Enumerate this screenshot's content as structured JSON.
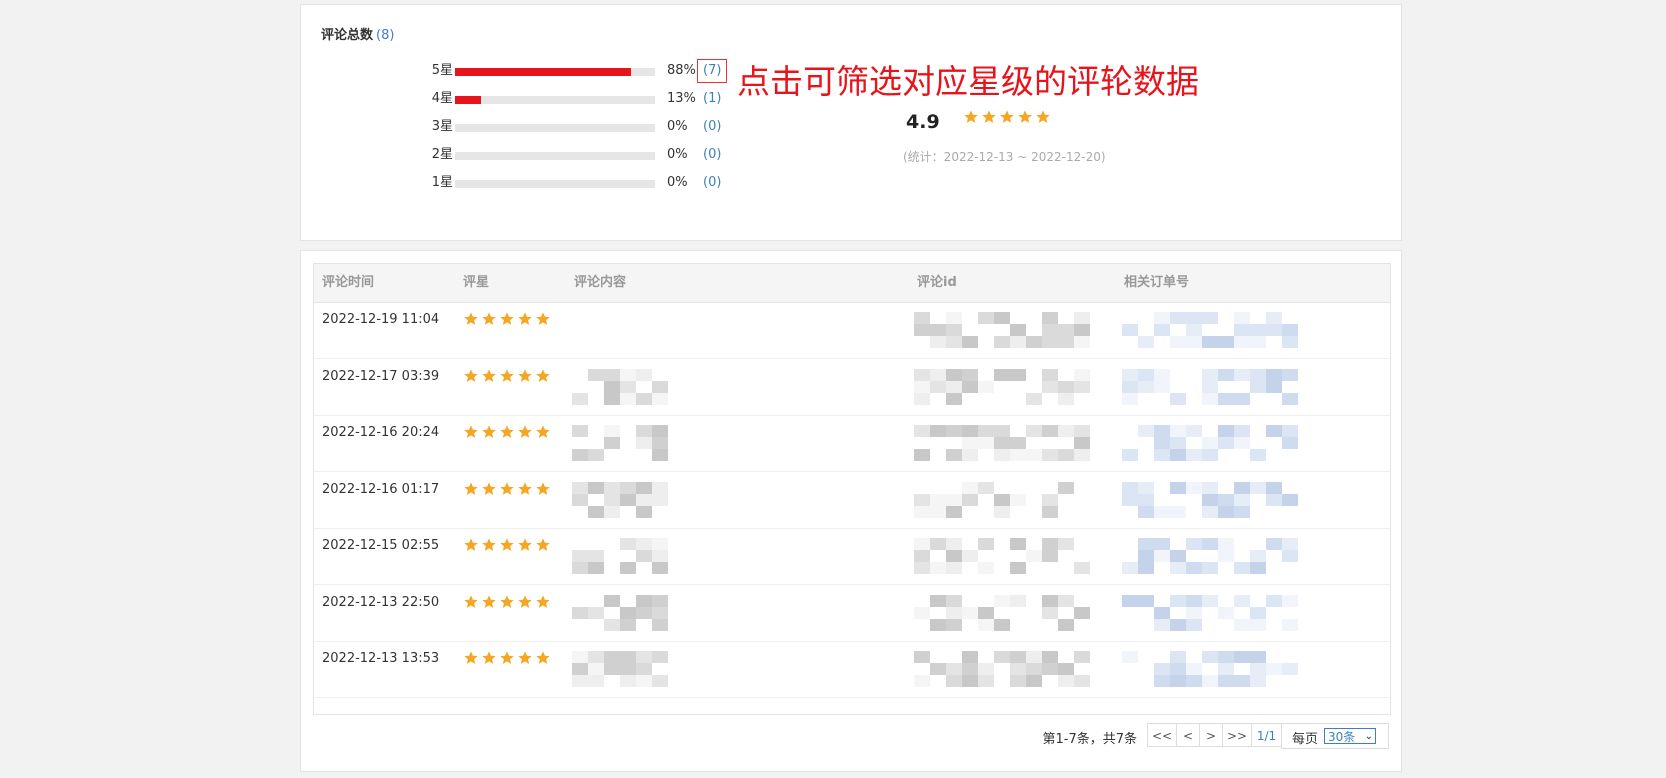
{
  "summary": {
    "title": "评论总数",
    "total": "(8)",
    "average": "4.9",
    "stat_range": "(统计：2022-12-13 ~ 2022-12-20)",
    "distribution": [
      {
        "label": "5星",
        "fraction": 0.88,
        "pct": "88%",
        "count": "(7)"
      },
      {
        "label": "4星",
        "fraction": 0.13,
        "pct": "13%",
        "count": "(1)"
      },
      {
        "label": "3星",
        "fraction": 0.0,
        "pct": "0%",
        "count": "(0)"
      },
      {
        "label": "2星",
        "fraction": 0.0,
        "pct": "0%",
        "count": "(0)"
      },
      {
        "label": "1星",
        "fraction": 0.0,
        "pct": "0%",
        "count": "(0)"
      }
    ],
    "annotation": "点击可筛选对应星级的评轮数据"
  },
  "table": {
    "headers": [
      "评论时间",
      "评星",
      "评论内容",
      "评论id",
      "相关订单号"
    ],
    "rows": [
      {
        "time": "2022-12-19 11:04",
        "stars": 5
      },
      {
        "time": "2022-12-17 03:39",
        "stars": 5
      },
      {
        "time": "2022-12-16 20:24",
        "stars": 5
      },
      {
        "time": "2022-12-16 01:17",
        "stars": 5
      },
      {
        "time": "2022-12-15 02:55",
        "stars": 5
      },
      {
        "time": "2022-12-13 22:50",
        "stars": 5
      },
      {
        "time": "2022-12-13 13:53",
        "stars": 5
      }
    ]
  },
  "pager": {
    "info": "第1-7条，共7条",
    "first": "<<",
    "prev": "<",
    "next": ">",
    "last": ">>",
    "page": "1/1",
    "per_label": "每页",
    "per_value": "30条"
  },
  "colors": {
    "bar": "#e8141b",
    "star": "#f5a623",
    "link": "#3d7fc4"
  }
}
